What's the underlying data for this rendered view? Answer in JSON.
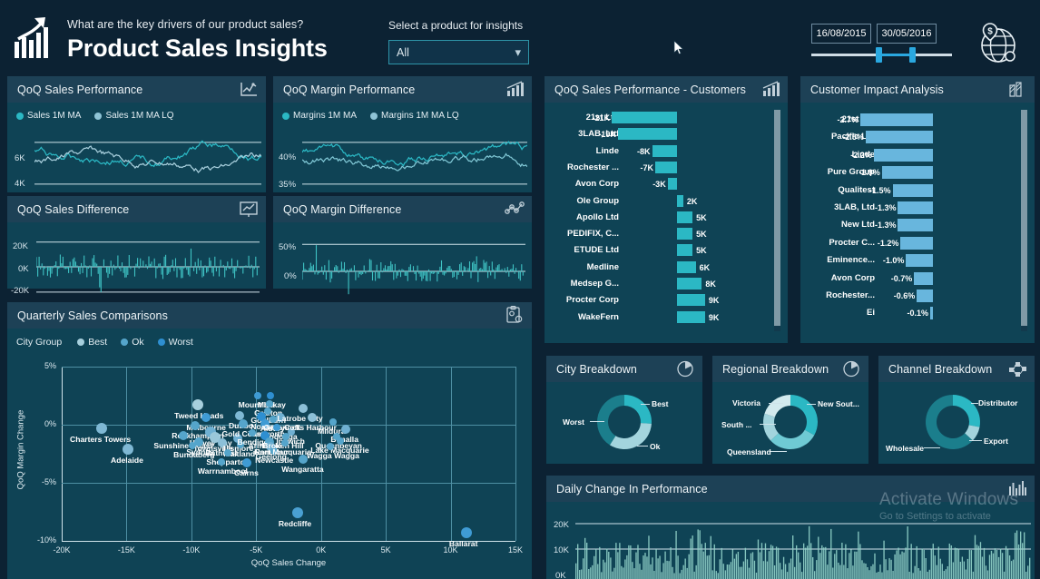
{
  "header": {
    "question": "What are the key drivers of our product sales?",
    "title": "Product Sales Insights",
    "slicer_label": "Select a product for insights",
    "slicer_value": "All",
    "date_from": "16/08/2015",
    "date_to": "30/05/2016",
    "logo_icon": "bar-chart-growth-icon",
    "globe_icon": "globe-money-icon",
    "cursor_icon": "mouse-pointer"
  },
  "colors": {
    "page_bg": "#0c2233",
    "panel_bg": "#0f4355",
    "panel_header_bg": "#1d4156",
    "accent_teal": "#2aa8a0",
    "accent_cyan": "#2bb8c4",
    "accent_light_blue": "#68b6dd",
    "accent_blue": "#2aa8e0",
    "text": "#ffffff",
    "slicer_border": "#2e94a8"
  },
  "panels": {
    "qoq_sales_performance": {
      "title": "QoQ Sales Performance",
      "icon": "line-chart-icon",
      "legend": [
        {
          "label": "Sales 1M MA",
          "color": "#2bb8c4"
        },
        {
          "label": "Sales 1M MA LQ",
          "color": "#8fc4d6"
        }
      ],
      "y_ticks": [
        "6K",
        "4K"
      ]
    },
    "qoq_sales_difference": {
      "title": "QoQ Sales Difference",
      "icon": "chart-presentation-icon",
      "y_ticks": [
        "20K",
        "0K",
        "-20K"
      ]
    },
    "qoq_margin_performance": {
      "title": "QoQ Margin Performance",
      "icon": "bar-chart-increase-icon",
      "legend": [
        {
          "label": "Margins 1M MA",
          "color": "#2bb8c4"
        },
        {
          "label": "Margins 1M MA LQ",
          "color": "#8fc4d6"
        }
      ],
      "y_ticks": [
        "40%",
        "35%"
      ]
    },
    "qoq_margin_difference": {
      "title": "QoQ Margin Difference",
      "icon": "network-nodes-icon",
      "y_ticks": [
        "50%",
        "0%"
      ]
    },
    "quarterly_sales_comparisons": {
      "title": "Quarterly Sales Comparisons",
      "icon": "clipboard-gear-icon",
      "legend_title": "City Group",
      "legend": [
        {
          "label": "Best",
          "color": "#a7cfdd"
        },
        {
          "label": "Ok",
          "color": "#55a5cb"
        },
        {
          "label": "Worst",
          "color": "#2e8fd1"
        }
      ]
    },
    "qoq_sales_customers": {
      "title": "QoQ Sales Performance - Customers",
      "icon": "bar-chart-increase-icon"
    },
    "customer_impact": {
      "title": "Customer Impact Analysis",
      "icon": "hatched-chart-icon"
    },
    "city_breakdown": {
      "title": "City Breakdown",
      "icon": "pie-chart-icon"
    },
    "regional_breakdown": {
      "title": "Regional Breakdown",
      "icon": "pie-chart-icon"
    },
    "channel_breakdown": {
      "title": "Channel Breakdown",
      "icon": "nodes-network-icon"
    },
    "daily_change": {
      "title": "Daily Change In Performance",
      "icon": "column-chart-icon",
      "y_ticks": [
        "20K",
        "10K",
        "0K"
      ]
    }
  },
  "chart_data": [
    {
      "id": "qoq_sales_customers",
      "type": "bar",
      "title": "QoQ Sales Performance - Customers",
      "orientation": "horizontal",
      "xlabel": "",
      "ylabel": "",
      "categories": [
        "21st Ltd",
        "3LAB, Ltd",
        "Linde",
        "Rochester ...",
        "Avon Corp",
        "Ole Group",
        "Apollo Ltd",
        "PEDIFIX, C...",
        "ETUDE Ltd",
        "Medline",
        "Medsep G...",
        "Procter Corp",
        "WakeFern"
      ],
      "labels": [
        "-21K",
        "-19K",
        "-8K",
        "-7K",
        "-3K",
        "2K",
        "5K",
        "5K",
        "5K",
        "6K",
        "8K",
        "9K",
        "9K"
      ],
      "values": [
        -21000,
        -19000,
        -8000,
        -7000,
        -3000,
        2000,
        5000,
        5000,
        5000,
        6000,
        8000,
        9000,
        9000
      ],
      "bar_color": "#2bb8c4"
    },
    {
      "id": "customer_impact",
      "type": "bar",
      "title": "Customer Impact Analysis",
      "orientation": "horizontal",
      "xlabel": "",
      "ylabel": "",
      "categories": [
        "21st Ltd",
        "Pacific Ltd",
        "Linde",
        "Pure Group",
        "Qualitest",
        "3LAB, Ltd",
        "New Ltd",
        "Procter C...",
        "Eminence...",
        "Avon Corp",
        "Rochester...",
        "Ei"
      ],
      "labels": [
        "-2.7%",
        "-2.5%",
        "-2.2%",
        "-1.9%",
        "-1.5%",
        "-1.3%",
        "-1.3%",
        "-1.2%",
        "-1.0%",
        "-0.7%",
        "-0.6%",
        "-0.1%"
      ],
      "values": [
        -2.7,
        -2.5,
        -2.2,
        -1.9,
        -1.5,
        -1.3,
        -1.3,
        -1.2,
        -1.0,
        -0.7,
        -0.6,
        -0.1
      ],
      "bar_color": "#68b6dd"
    },
    {
      "id": "quarterly_sales_comparisons",
      "type": "scatter",
      "title": "Quarterly Sales Comparisons",
      "xlabel": "QoQ Sales Change",
      "ylabel": "QoQ Margin Change",
      "xlim": [
        -20000,
        15000
      ],
      "ylim": [
        -10,
        5
      ],
      "xticks": [
        "-20K",
        "-15K",
        "-10K",
        "-5K",
        "0K",
        "5K",
        "10K",
        "15K"
      ],
      "yticks": [
        "5%",
        "0%",
        "-5%",
        "-10%"
      ],
      "grid": true,
      "legend_position": "top-left",
      "points": [
        {
          "label": "Charters Towers",
          "x": -16900,
          "y": -0.3,
          "r": 6,
          "color": "#7fb8d4"
        },
        {
          "label": "Adelaide",
          "x": -14900,
          "y": -2.1,
          "r": 6,
          "color": "#7fb8d4"
        },
        {
          "label": "Tweed Heads",
          "x": -9500,
          "y": 1.7,
          "r": 6,
          "color": "#a7cfdd"
        },
        {
          "label": "Melbourne",
          "x": -8900,
          "y": 0.6,
          "r": 5,
          "color": "#3f9bd4"
        },
        {
          "label": "Rockhampton",
          "x": -9700,
          "y": -0.1,
          "r": 5,
          "color": "#55a5cb"
        },
        {
          "label": "Sunshine Coast",
          "x": -10600,
          "y": -0.9,
          "r": 5,
          "color": "#55a5cb"
        },
        {
          "label": "Hervey Bay",
          "x": -8500,
          "y": -0.6,
          "r": 6,
          "color": "#6fb0d2"
        },
        {
          "label": "Townsville",
          "x": -8200,
          "y": -1.1,
          "r": 6,
          "color": "#9ac8da"
        },
        {
          "label": "Sydney",
          "x": -9400,
          "y": -1.5,
          "r": 5,
          "color": "#55a5cb"
        },
        {
          "label": "Bundaberg",
          "x": -9900,
          "y": -1.8,
          "r": 4,
          "color": "#55a5cb"
        },
        {
          "label": "Bathurst",
          "x": -7600,
          "y": -1.6,
          "r": 5,
          "color": "#8cc0d8"
        },
        {
          "label": "Lismore",
          "x": -6400,
          "y": -1.2,
          "r": 5,
          "color": "#6fb0d2"
        },
        {
          "label": "Maitland",
          "x": -6200,
          "y": -1.7,
          "r": 4,
          "color": "#55a5cb"
        },
        {
          "label": "Shepparton",
          "x": -7200,
          "y": -2.4,
          "r": 4,
          "color": "#55a5cb"
        },
        {
          "label": "Warrnambool",
          "x": -7700,
          "y": -3.2,
          "r": 4,
          "color": "#55a5cb"
        },
        {
          "label": "Cairns",
          "x": -5700,
          "y": -3.3,
          "r": 5,
          "color": "#3f9bd4"
        },
        {
          "label": "Dubbo",
          "x": -6300,
          "y": 0.8,
          "r": 5,
          "color": "#7fb8d4"
        },
        {
          "label": "Gold Coast",
          "x": -6000,
          "y": 0.1,
          "r": 5,
          "color": "#55a5cb"
        },
        {
          "label": "Mount Isa",
          "x": -4900,
          "y": 2.5,
          "r": 4,
          "color": "#3f9bd4"
        },
        {
          "label": "Mackay",
          "x": -3900,
          "y": 2.5,
          "r": 4,
          "color": "#2e8fd1"
        },
        {
          "label": "Grafton",
          "x": -4000,
          "y": 1.8,
          "r": 4,
          "color": "#55a5cb"
        },
        {
          "label": "Goulburn",
          "x": -4100,
          "y": 1.2,
          "r": 4,
          "color": "#55a5cb"
        },
        {
          "label": "Nowra",
          "x": -4600,
          "y": 0.7,
          "r": 5,
          "color": "#2e8fd1"
        },
        {
          "label": "Tamworth",
          "x": -4300,
          "y": 0.1,
          "r": 5,
          "color": "#3f9bd4"
        },
        {
          "label": "Albury",
          "x": -3700,
          "y": 0.5,
          "r": 4,
          "color": "#55a5cb"
        },
        {
          "label": "Cessnock",
          "x": -3100,
          "y": 0.6,
          "r": 5,
          "color": "#6fb0d2"
        },
        {
          "label": "Wodonga",
          "x": -3400,
          "y": -0.2,
          "r": 4,
          "color": "#3f9bd4"
        },
        {
          "label": "Bendigo",
          "x": -5300,
          "y": -0.7,
          "r": 4,
          "color": "#55a5cb"
        },
        {
          "label": "Armidale",
          "x": -4300,
          "y": -0.9,
          "r": 5,
          "color": "#2e8fd1"
        },
        {
          "label": "Nambour",
          "x": -4000,
          "y": -1.5,
          "r": 5,
          "color": "#55a5cb"
        },
        {
          "label": "Geelong",
          "x": -3900,
          "y": -1.9,
          "r": 5,
          "color": "#6fb0d2"
        },
        {
          "label": "Newcastle",
          "x": -3600,
          "y": -2.3,
          "r": 4,
          "color": "#55a5cb"
        },
        {
          "label": "Ipswich",
          "x": -2300,
          "y": -0.6,
          "r": 4,
          "color": "#6fb0d2"
        },
        {
          "label": "Broken Hill",
          "x": -2700,
          "y": -1.0,
          "r": 4,
          "color": "#55a5cb"
        },
        {
          "label": "Port Macquarie",
          "x": -2800,
          "y": -1.6,
          "r": 4,
          "color": "#55a5cb"
        },
        {
          "label": "Latrobe City",
          "x": -1400,
          "y": 1.4,
          "r": 5,
          "color": "#8cc0d8"
        },
        {
          "label": "Coffs Harbour",
          "x": -700,
          "y": 0.6,
          "r": 5,
          "color": "#8cc0d8"
        },
        {
          "label": "Mildura",
          "x": 900,
          "y": 0.2,
          "r": 4,
          "color": "#55a5cb"
        },
        {
          "label": "Benalla",
          "x": 1900,
          "y": -0.4,
          "r": 5,
          "color": "#6fb0d2"
        },
        {
          "label": "Queanbeyan",
          "x": 1200,
          "y": -1.0,
          "r": 4,
          "color": "#55a5cb"
        },
        {
          "label": "Lake Macquarie",
          "x": 1500,
          "y": -1.4,
          "r": 4,
          "color": "#55a5cb"
        },
        {
          "label": "Wagga Wagga",
          "x": 700,
          "y": -1.9,
          "r": 4,
          "color": "#55a5cb"
        },
        {
          "label": "Wangaratta",
          "x": -1400,
          "y": -3.0,
          "r": 5,
          "color": "#55a5cb"
        },
        {
          "label": "Redcliffe",
          "x": -1800,
          "y": -7.6,
          "r": 6,
          "color": "#4aa0d2"
        },
        {
          "label": "Ballarat",
          "x": 11200,
          "y": -9.3,
          "r": 6,
          "color": "#3f9bd4"
        }
      ]
    },
    {
      "id": "city_breakdown",
      "type": "pie",
      "title": "City Breakdown",
      "labels": [
        "Best",
        "Ok",
        "Worst"
      ],
      "values": [
        26,
        33,
        41
      ],
      "colors": [
        "#2bb8c4",
        "#a3d4dd",
        "#1b7e8c"
      ]
    },
    {
      "id": "regional_breakdown",
      "type": "pie",
      "title": "Regional Breakdown",
      "labels": [
        "New Sout...",
        "Queensland",
        "South ...",
        "Victoria"
      ],
      "values": [
        33,
        30,
        17,
        20
      ],
      "colors": [
        "#2bb8c4",
        "#6fcad4",
        "#a3d4dd",
        "#d2eaee"
      ]
    },
    {
      "id": "channel_breakdown",
      "type": "pie",
      "title": "Channel Breakdown",
      "labels": [
        "Distributor",
        "Export",
        "Wholesale"
      ],
      "values": [
        28,
        9,
        63
      ],
      "colors": [
        "#2bb8c4",
        "#a3d4dd",
        "#1b7e8c"
      ]
    },
    {
      "id": "daily_change",
      "type": "bar",
      "title": "Daily Change In Performance",
      "ylabel": "",
      "yticks": [
        "20K",
        "10K",
        "0K"
      ],
      "ylim": [
        0,
        22000
      ],
      "bar_color": "#8fd0c8"
    },
    {
      "id": "qoq_sales_performance",
      "type": "line",
      "title": "QoQ Sales Performance",
      "yticks": [
        "6K",
        "4K"
      ],
      "ylim": [
        3400,
        6800
      ],
      "series": [
        {
          "name": "Sales 1M MA",
          "color": "#2bb8c4"
        },
        {
          "name": "Sales 1M MA LQ",
          "color": "#8fc4d6"
        }
      ]
    },
    {
      "id": "qoq_margin_performance",
      "type": "line",
      "title": "QoQ Margin Performance",
      "yticks": [
        "40%",
        "35%"
      ],
      "ylim": [
        34,
        42
      ],
      "series": [
        {
          "name": "Margins 1M MA",
          "color": "#2bb8c4"
        },
        {
          "name": "Margins 1M MA LQ",
          "color": "#8fc4d6"
        }
      ]
    },
    {
      "id": "qoq_sales_difference",
      "type": "bar",
      "title": "QoQ Sales Difference",
      "yticks": [
        "20K",
        "0K",
        "-20K"
      ],
      "ylim": [
        -25000,
        25000
      ],
      "bar_color": "#3fc3c4"
    },
    {
      "id": "qoq_margin_difference",
      "type": "bar",
      "title": "QoQ Margin Difference",
      "yticks": [
        "50%",
        "0%"
      ],
      "ylim": [
        -30,
        60
      ],
      "bar_color": "#3fc3c4"
    }
  ],
  "watermark": {
    "line1": "Activate Windows",
    "line2": "Go to Settings to activate"
  }
}
